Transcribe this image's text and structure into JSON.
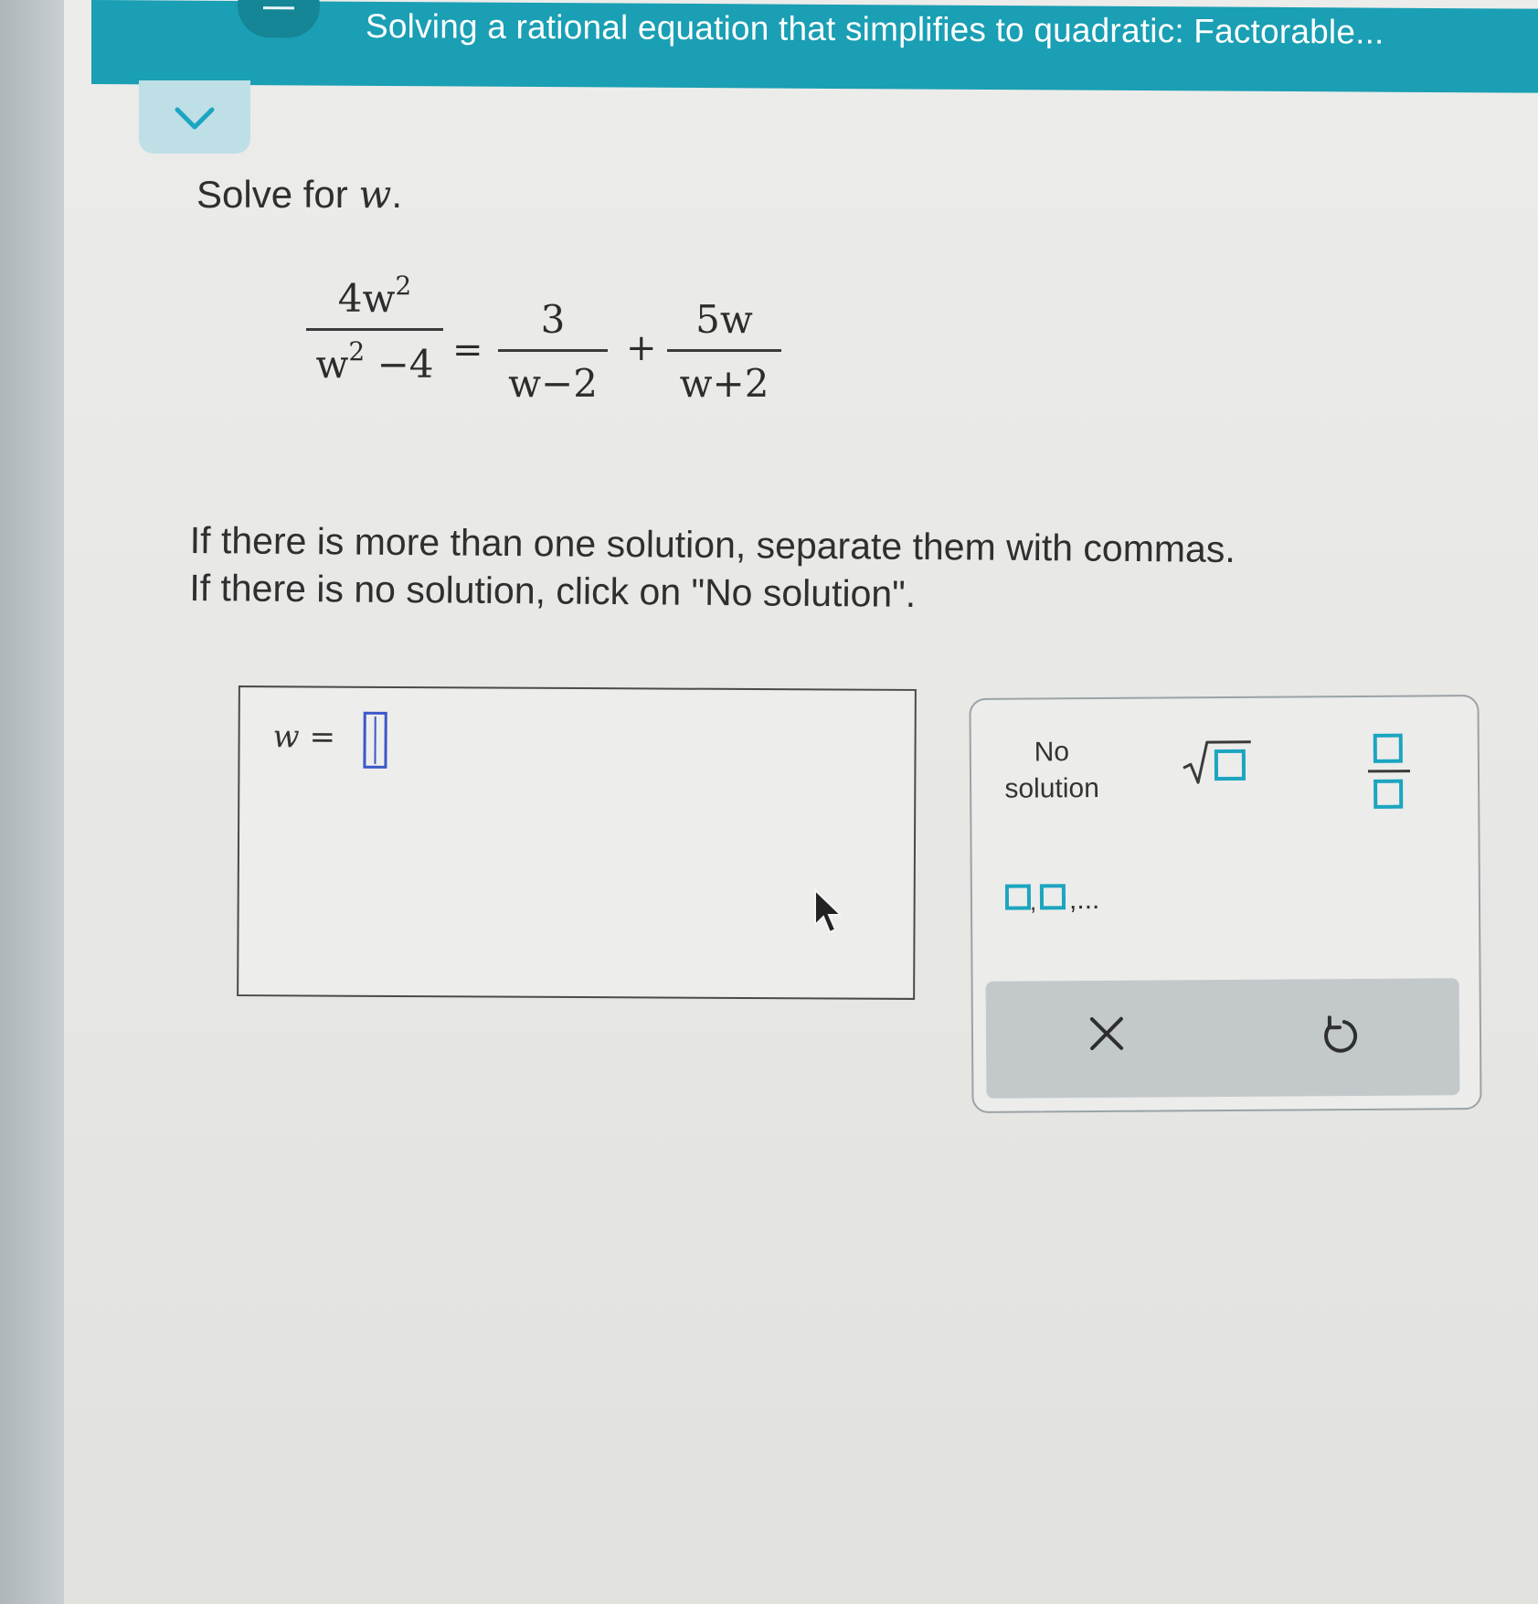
{
  "header": {
    "title": "Solving a rational equation that simplifies to quadratic: Factorable..."
  },
  "problem": {
    "prompt_text": "Solve for ",
    "variable": "w",
    "prompt_end": ".",
    "equation": {
      "lhs_num": "4w",
      "lhs_num_exp": "2",
      "lhs_den_base": "w",
      "lhs_den_exp": "2",
      "lhs_den_rest": " −4",
      "equals": "=",
      "term1_num": "3",
      "term1_den": "w−2",
      "plus": "+",
      "term2_num": "5w",
      "term2_den": "w+2"
    },
    "instruction_line1": "If there is more than one solution, separate them with commas.",
    "instruction_line2": "If there is no solution, click on \"No solution\"."
  },
  "answer": {
    "variable": "w",
    "equals": " ="
  },
  "keypad": {
    "no_solution_line1": "No",
    "no_solution_line2": "solution",
    "list_suffix": ",..."
  },
  "icons": {
    "collapse": "chevron-down-icon",
    "sqrt": "square-root-icon",
    "fraction": "fraction-icon",
    "clear": "close-icon",
    "undo": "undo-icon"
  },
  "colors": {
    "header": "#1a9fb4",
    "accent": "#3b57c9",
    "keypad_icon": "#1ba5c0"
  }
}
